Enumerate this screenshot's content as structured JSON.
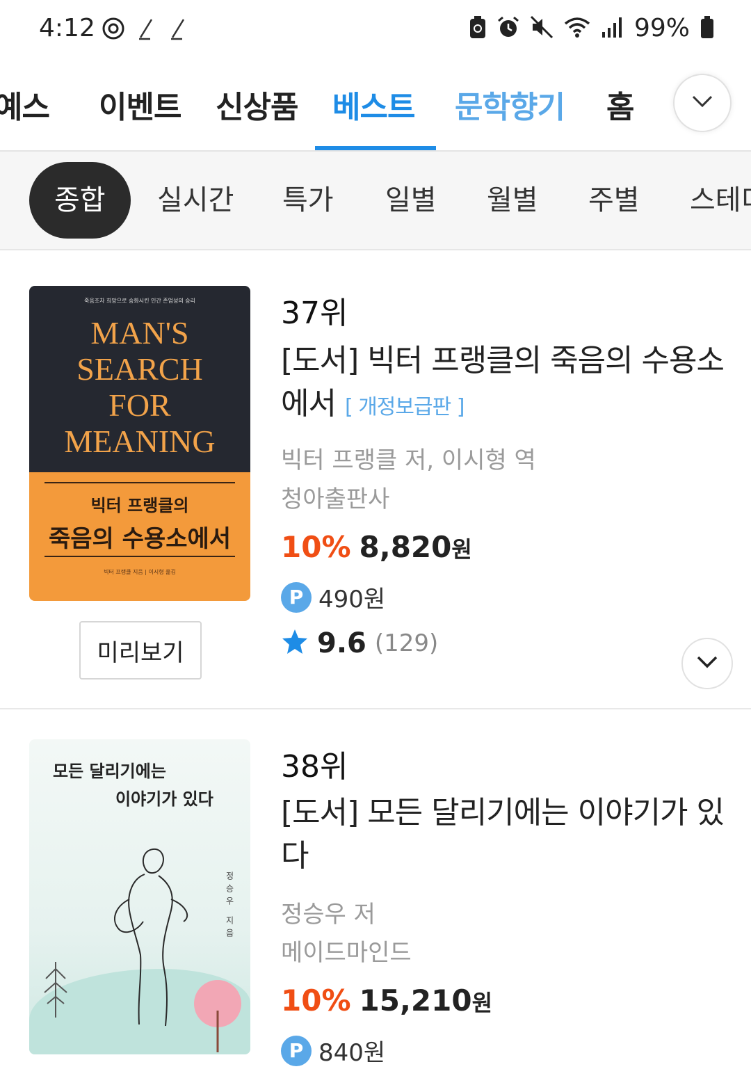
{
  "status_bar": {
    "time": "4:12",
    "battery": "99%",
    "icons": [
      "target-icon",
      "pen-icon",
      "pen-icon",
      "battery-saver-icon",
      "alarm-icon",
      "mute-icon",
      "wifi-icon",
      "signal-icon",
      "battery-icon"
    ]
  },
  "top_tabs": {
    "items": [
      "예스",
      "이벤트",
      "신상품",
      "베스트",
      "문학향기",
      "홈"
    ],
    "active": "베스트",
    "more_icon": "chevron-down-icon"
  },
  "sub_filters": {
    "items": [
      "종합",
      "실시간",
      "특가",
      "일별",
      "월별",
      "주별",
      "스테디"
    ],
    "active": "종합"
  },
  "books": [
    {
      "rank": "37위",
      "title": "[도서] 빅터 프랭클의 죽음의 수용소에서",
      "edition": "[ 개정보급판 ]",
      "author": "빅터 프랭클 저, 이시형 역",
      "publisher": "청아출판사",
      "discount": "10%",
      "price": "8,820",
      "currency": "원",
      "points": "490원",
      "rating": "9.6",
      "review_count": "(129)",
      "preview_label": "미리보기",
      "cover": {
        "tagline": "죽음조차 희망으로 승화시킨 인간 존엄성의 승리",
        "en_title_lines": [
          "MAN'S",
          "SEARCH",
          "FOR",
          "MEANING"
        ],
        "ko_line1": "빅터 프랭클의",
        "ko_line2": "죽음의 수용소에서",
        "credit": "빅터 프랭클 지음 | 이시형 옮김"
      }
    },
    {
      "rank": "38위",
      "title": "[도서] 모든 달리기에는 이야기가 있다",
      "author": "정승우 저",
      "publisher": "메이드마인드",
      "discount": "10%",
      "price": "15,210",
      "currency": "원",
      "points": "840원",
      "cover": {
        "title_line1": "모든 달리기에는",
        "title_line2": "이야기가 있다",
        "author": "정승우 지음"
      }
    }
  ],
  "colors": {
    "accent_blue": "#1e8ce6",
    "discount_orange": "#f04e14",
    "chip_dark": "#2b2b2b"
  }
}
